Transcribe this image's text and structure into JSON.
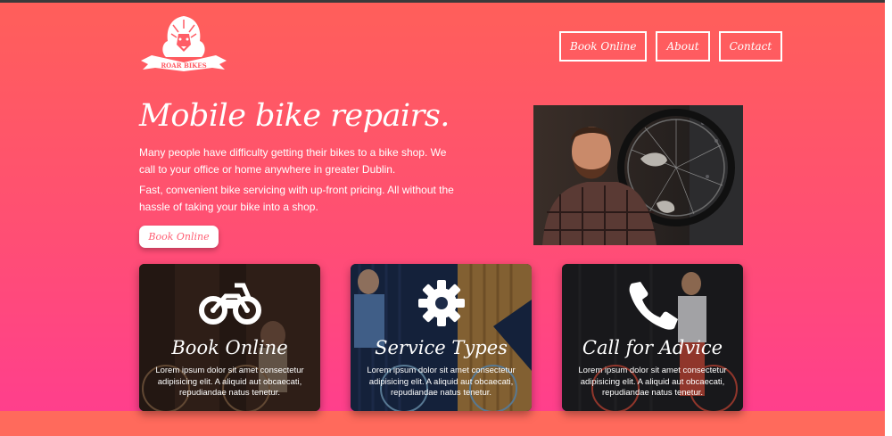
{
  "brand": {
    "logo_text": "ROAR BIKES"
  },
  "nav": {
    "items": [
      "Book Online",
      "About",
      "Contact"
    ]
  },
  "hero": {
    "headline": "Mobile bike repairs.",
    "paragraph_1": "Many people have difficulty getting their bikes to a bike shop. We call to your office or home anywhere in greater Dublin.",
    "paragraph_2": "Fast, convenient bike servicing with up-front pricing. All without the hassle of taking your bike into a shop.",
    "cta_label": "Book Online"
  },
  "cards": [
    {
      "title": "Book Online",
      "icon": "motorcycle-icon",
      "text": "Lorem ipsum dolor sit amet consectetur adipisicing elit. A aliquid aut obcaecati, repudiandae natus tenetur."
    },
    {
      "title": "Service Types",
      "icon": "gear-icon",
      "text": "Lorem ipsum dolor sit amet consectetur adipisicing elit. A aliquid aut obcaecati, repudiandae natus tenetur."
    },
    {
      "title": "Call for Advice",
      "icon": "phone-icon",
      "text": "Lorem ipsum dolor sit amet consectetur adipisicing elit. A aliquid aut obcaecati, repudiandae natus tenetur."
    }
  ],
  "colors": {
    "gradient_top": "#ff5f5a",
    "gradient_bottom": "#ff3f8c",
    "button_text": "#ff5f74"
  }
}
